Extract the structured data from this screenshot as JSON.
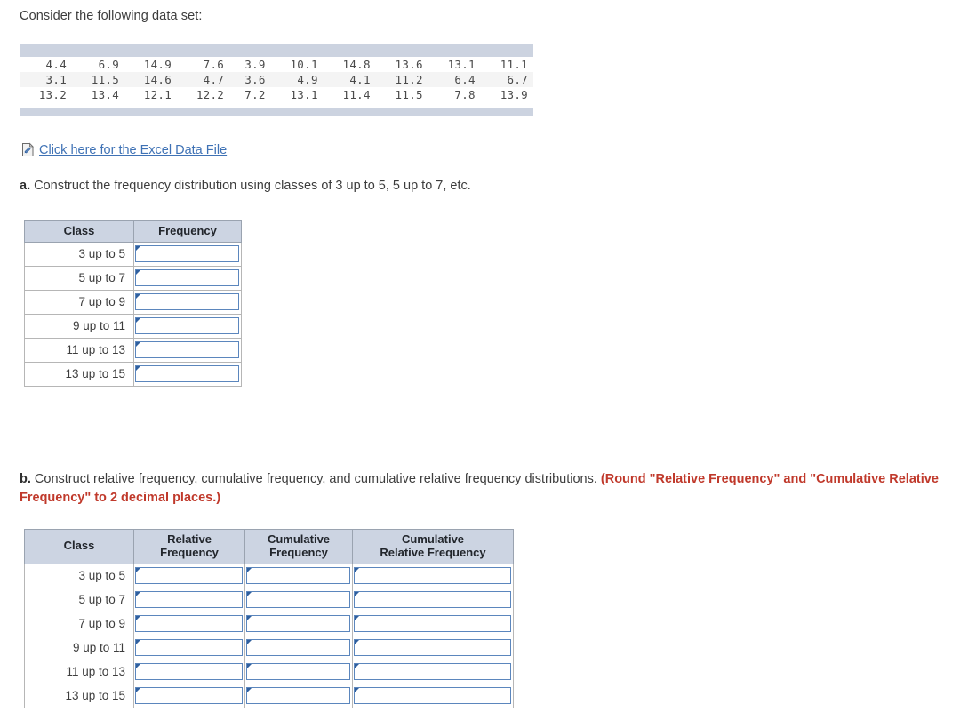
{
  "intro": "Consider the following data set:",
  "dataset": {
    "rows": [
      [
        "4.4",
        "6.9",
        "14.9",
        "7.6",
        "3.9",
        "10.1",
        "14.8",
        "13.6",
        "13.1",
        "11.1"
      ],
      [
        "3.1",
        "11.5",
        "14.6",
        "4.7",
        "3.6",
        "4.9",
        "4.1",
        "11.2",
        "6.4",
        "6.7"
      ],
      [
        "13.2",
        "13.4",
        "12.1",
        "12.2",
        "7.2",
        "13.1",
        "11.4",
        "11.5",
        "7.8",
        "13.9"
      ]
    ]
  },
  "excel_link": {
    "icon": "excel-file-icon",
    "label": "Click here for the Excel Data File"
  },
  "part_a": {
    "label": "a.",
    "text": " Construct the frequency distribution using classes of 3 up to 5, 5 up to 7, etc.",
    "table": {
      "headers": [
        "Class",
        "Frequency"
      ],
      "classes": [
        "3 up to 5",
        "5 up to 7",
        "7 up to 9",
        "9 up to 11",
        "11 up to 13",
        "13 up to 15"
      ],
      "values": [
        "",
        "",
        "",
        "",
        "",
        ""
      ]
    }
  },
  "part_b": {
    "label": "b.",
    "text": " Construct relative frequency, cumulative frequency, and cumulative relative frequency distributions. ",
    "round_note": "(Round \"Relative Frequency\" and \"Cumulative Relative Frequency\" to 2 decimal places.)",
    "table": {
      "headers": [
        "Class",
        "Relative\nFrequency",
        "Cumulative\nFrequency",
        "Cumulative\nRelative Frequency"
      ],
      "header_lines": {
        "class": "Class",
        "rf_line1": "Relative",
        "rf_line2": "Frequency",
        "cf_line1": "Cumulative",
        "cf_line2": "Frequency",
        "crf_line1": "Cumulative",
        "crf_line2": "Relative Frequency"
      },
      "classes": [
        "3 up to 5",
        "5 up to 7",
        "7 up to 9",
        "9 up to 11",
        "11 up to 13",
        "13 up to 15"
      ],
      "values": [
        [
          "",
          "",
          ""
        ],
        [
          "",
          "",
          ""
        ],
        [
          "",
          "",
          ""
        ],
        [
          "",
          "",
          ""
        ],
        [
          "",
          "",
          ""
        ],
        [
          "",
          "",
          ""
        ]
      ]
    }
  },
  "colors": {
    "header_bg": "#ccd4e2",
    "input_border": "#5b86bd",
    "input_flag": "#2f5f9e",
    "link": "#3f72b5",
    "round_note": "#c0392b",
    "dataset_bar": "#ccd3e0"
  }
}
